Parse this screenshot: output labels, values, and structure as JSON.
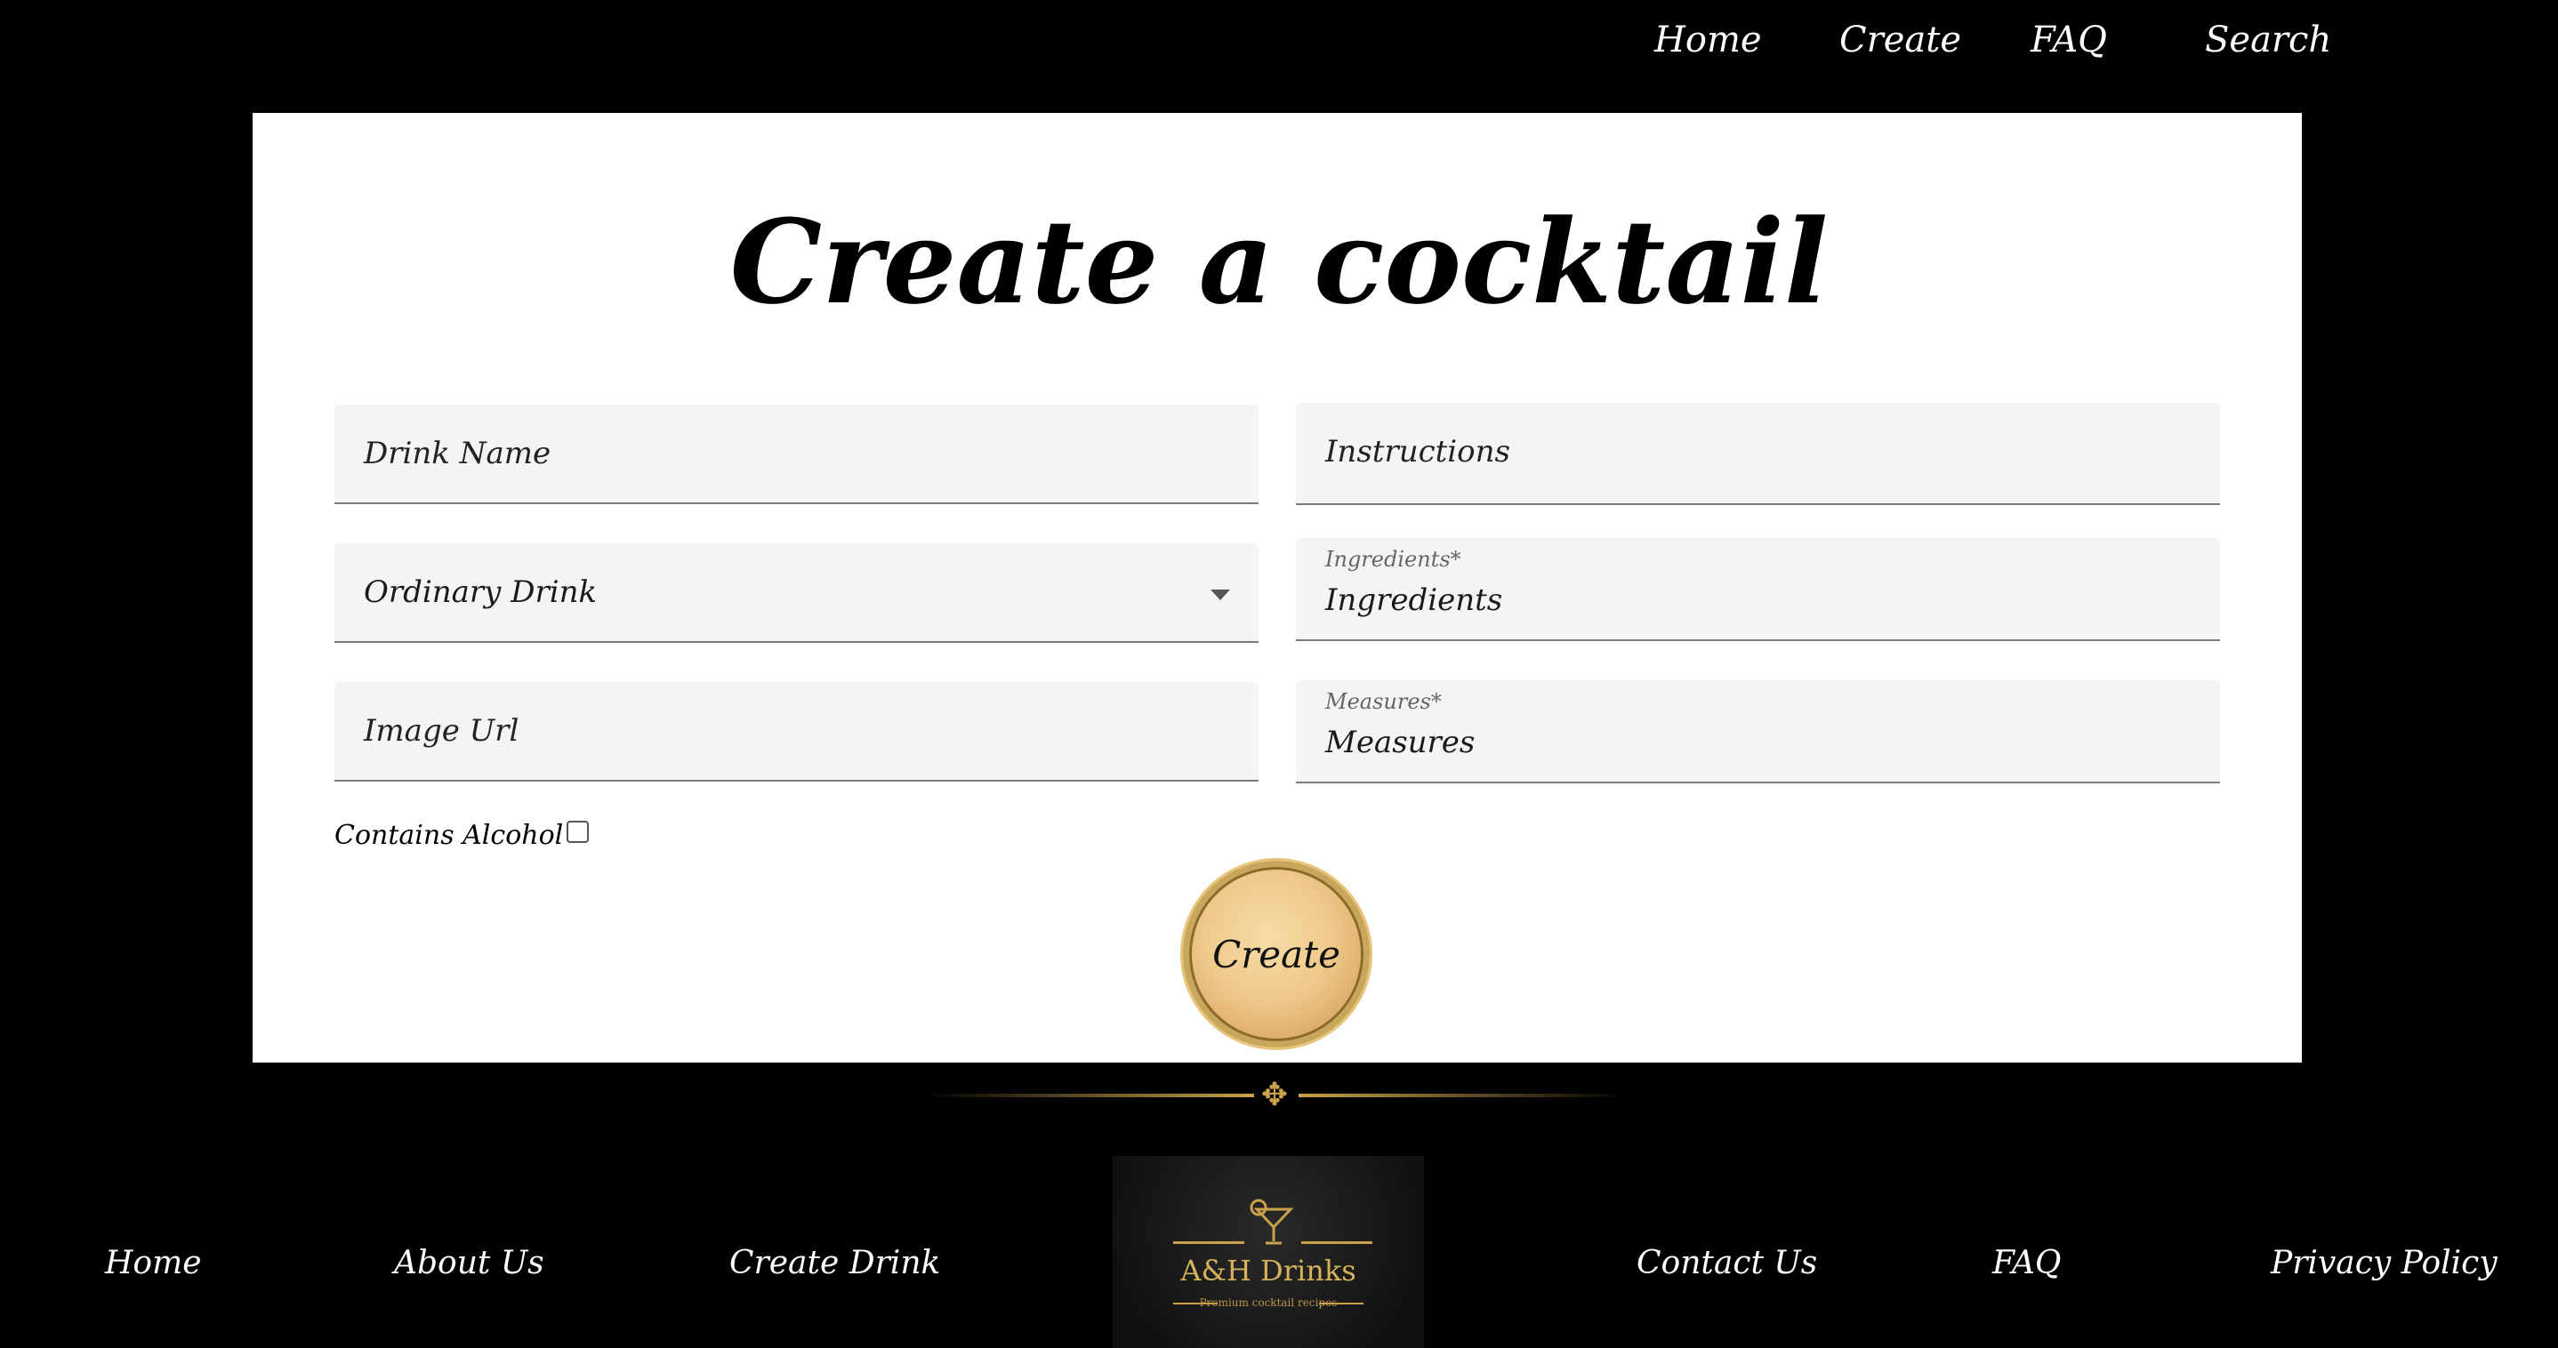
{
  "topnav": {
    "home": "Home",
    "create": "Create",
    "faq": "FAQ",
    "search": "Search"
  },
  "main": {
    "title": "Create a cocktail",
    "drink_name_placeholder": "Drink Name",
    "category_value": "Ordinary Drink",
    "image_url_placeholder": "Image Url",
    "instructions_placeholder": "Instructions",
    "ingredients_label": "Ingredients*",
    "ingredients_value": "Ingredients",
    "measures_label": "Measures*",
    "measures_value": "Measures",
    "contains_alcohol_label": "Contains Alcohol",
    "create_button": "Create"
  },
  "footer": {
    "home": "Home",
    "about": "About Us",
    "create_drink": "Create Drink",
    "contact": "Contact Us",
    "faq": "FAQ",
    "privacy": "Privacy Policy",
    "logo_brand": "A&H Drinks",
    "logo_tagline": "Premium cocktail recipes"
  },
  "colors": {
    "background": "#000000",
    "card": "#ffffff",
    "field_fill": "#f4f4f4",
    "gold": "#c9a24a"
  },
  "icons": {
    "dropdown": "chevron-down-icon",
    "divider_ornament": "fleur-ornament-icon",
    "logo_glass": "cocktail-glass-icon"
  }
}
